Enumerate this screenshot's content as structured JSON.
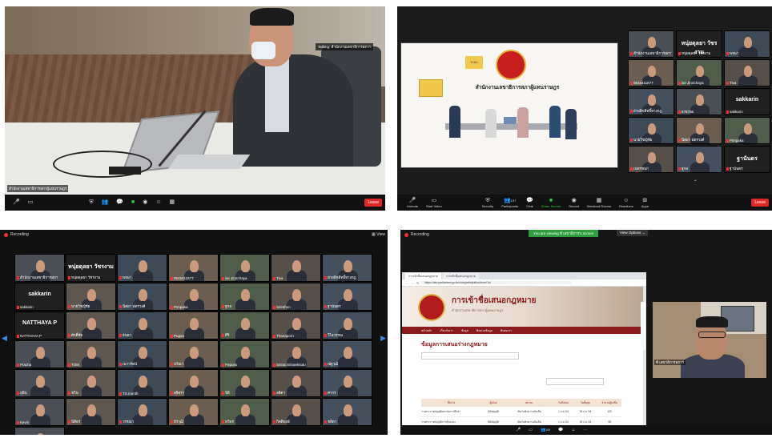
{
  "panel1": {
    "talking_label": "Talking: สำนักงานเลขาธิการสภาฯ",
    "name_label": "สำนักงานเลขาธิการสภาผู้แทนราษฎร",
    "toolbar": [
      "Unmute",
      "Start Video",
      "Security",
      "Participants",
      "Chat",
      "Share Screen",
      "Record",
      "Reactions",
      "Apps"
    ],
    "leave": "Leave"
  },
  "panel2": {
    "slide_title": "สำนักงานเลขาธิการสภาผู้แทนราษฎร",
    "slide_badge": "ระบบ",
    "tiles": [
      {
        "name": "สำนักงานเลขาธิการสภา",
        "big": ""
      },
      {
        "name": "หนุ่ยดุลยา วัชรงาม",
        "big": "หนุ่ยดุลยา วัชรงาม"
      },
      {
        "name": "พจนา",
        "big": ""
      },
      {
        "name": "0615411877",
        "big": ""
      },
      {
        "name": "ise Jirutchaya",
        "big": ""
      },
      {
        "name": "Tiva",
        "big": ""
      },
      {
        "name": "ฝ่ายลิขสิทธิ์ทางกฎ",
        "big": ""
      },
      {
        "name": "678796",
        "big": ""
      },
      {
        "name": "sakkarin",
        "big": "sakkarin"
      },
      {
        "name": "นายวิชญ์ชัย",
        "big": ""
      },
      {
        "name": "นิตยา ฉัตรวงศ์",
        "big": ""
      },
      {
        "name": "Pimpaka",
        "big": ""
      },
      {
        "name": "เนตรชนก",
        "big": ""
      },
      {
        "name": "ฐูกล",
        "big": ""
      },
      {
        "name": "ฐานันดร",
        "big": "ฐานันดร"
      }
    ],
    "toolbar": [
      "Unmute",
      "Start Video",
      "Security",
      "Participants",
      "Chat",
      "Share Screen",
      "Record",
      "Breakout Rooms",
      "Reactions",
      "Apps"
    ],
    "participants_count": "107",
    "leave": "Leave"
  },
  "panel3": {
    "recording": "Recording",
    "view": "View",
    "tiles": [
      {
        "name": "สำนักงานเลขาธิการสภา",
        "big": ""
      },
      {
        "name": "หนุ่ยดุลยา วัชรงาม",
        "big": "หนุ่ยดุลยา วัชรงาม"
      },
      {
        "name": "พจนา",
        "big": ""
      },
      {
        "name": "0615411877",
        "big": ""
      },
      {
        "name": "ise Jirutchaya",
        "big": ""
      },
      {
        "name": "Tiva",
        "big": ""
      },
      {
        "name": "ฝ่ายลิขสิทธิ์ทางกฎ",
        "big": ""
      },
      {
        "name": "sakkarin",
        "big": "sakkarin"
      },
      {
        "name": "นายวิชญ์ชัย",
        "big": ""
      },
      {
        "name": "นิตยา ฉัตรวงศ์",
        "big": ""
      },
      {
        "name": "Pimpaka",
        "big": ""
      },
      {
        "name": "ฐูกล",
        "big": ""
      },
      {
        "name": "Sirinthon",
        "big": ""
      },
      {
        "name": "ฐานันดร",
        "big": ""
      },
      {
        "name": "NATTHAYA P",
        "big": "NATTHAYA P"
      },
      {
        "name": "ศักดิ์ชัย",
        "big": ""
      },
      {
        "name": "ธันยา",
        "big": ""
      },
      {
        "name": "Pugsa",
        "big": ""
      },
      {
        "name": "ศิริ",
        "big": ""
      },
      {
        "name": "Thanaporn",
        "big": ""
      },
      {
        "name": "วิไลวรรณ",
        "big": ""
      },
      {
        "name": "Pracha",
        "big": ""
      },
      {
        "name": "TOM",
        "big": ""
      },
      {
        "name": "เนาวรัตน์",
        "big": ""
      },
      {
        "name": "ปวีณา",
        "big": ""
      },
      {
        "name": "Papuss",
        "big": ""
      },
      {
        "name": "Sirirat Srinaeksutu",
        "big": ""
      },
      {
        "name": "ณัฐวุฒิ",
        "big": ""
      },
      {
        "name": "ยุพิน",
        "big": ""
      },
      {
        "name": "ชวิน",
        "big": ""
      },
      {
        "name": "TS.month",
        "big": ""
      },
      {
        "name": "สุจิตรา",
        "big": ""
      },
      {
        "name": "นิธิ",
        "big": ""
      },
      {
        "name": "ลลิตา",
        "big": ""
      },
      {
        "name": "ศากร",
        "big": ""
      },
      {
        "name": "Kevin",
        "big": ""
      },
      {
        "name": "นิติธร",
        "big": ""
      },
      {
        "name": "วรรณา",
        "big": ""
      },
      {
        "name": "ธีรวุฒิ",
        "big": ""
      },
      {
        "name": "ทวีพร",
        "big": ""
      },
      {
        "name": "กิตติพงษ์",
        "big": ""
      },
      {
        "name": "ชลิดา",
        "big": ""
      },
      {
        "name": "Khlaa",
        "big": ""
      }
    ]
  },
  "panel4": {
    "recording": "Recording",
    "viewing_banner": "You are viewing ที่ เลขาธิการ's screen",
    "view_options": "View Options",
    "browser": {
      "tab1": "การเข้าชื่อเสนอกฎหมาย",
      "tab2": "การเข้าชื่อเสนอกฎหมาย",
      "url": "https://dev.parliament.go.th/civicparticipation/form/?pi",
      "search_placeholder": "ค้นหา",
      "header_title": "การเข้าชื่อเสนอกฎหมาย",
      "header_sub": "สำนักงานเลขาธิการสภาผู้แทนราษฎร",
      "nav": [
        "หน้าหลัก",
        "เกี่ยวกับเรา",
        "ข้อมูล",
        "ติดตามข้อมูล",
        "ติดต่อเรา"
      ],
      "section_title": "ข้อมูลการเสนอร่างกฎหมาย",
      "table_head": [
        "ชื่อร่าง",
        "ผู้เสนอ",
        "สถานะ",
        "วันที่เสนอ",
        "วันสิ้นสุด",
        "จำนวนผู้ลงชื่อ"
      ],
      "row1": [
        "ร่างพระราชบัญญัติสถาบันการศึกษา",
        "นิติบัญญัติ",
        "เปิดรับฟังความคิดเห็น",
        "1 ก.ย. 64",
        "30 ก.ย. 64",
        "120"
      ],
      "row2": [
        "ร่างพระราชบัญญัติการคุ้มครอง",
        "นิติบัญญัติ",
        "เปิดรับฟังความคิดเห็น",
        "1 ก.ย. 64",
        "30 ก.ย. 64",
        "98"
      ]
    },
    "speaker_name": "ที่ เลขาธิการสภาฯ",
    "participants_count": "109"
  }
}
